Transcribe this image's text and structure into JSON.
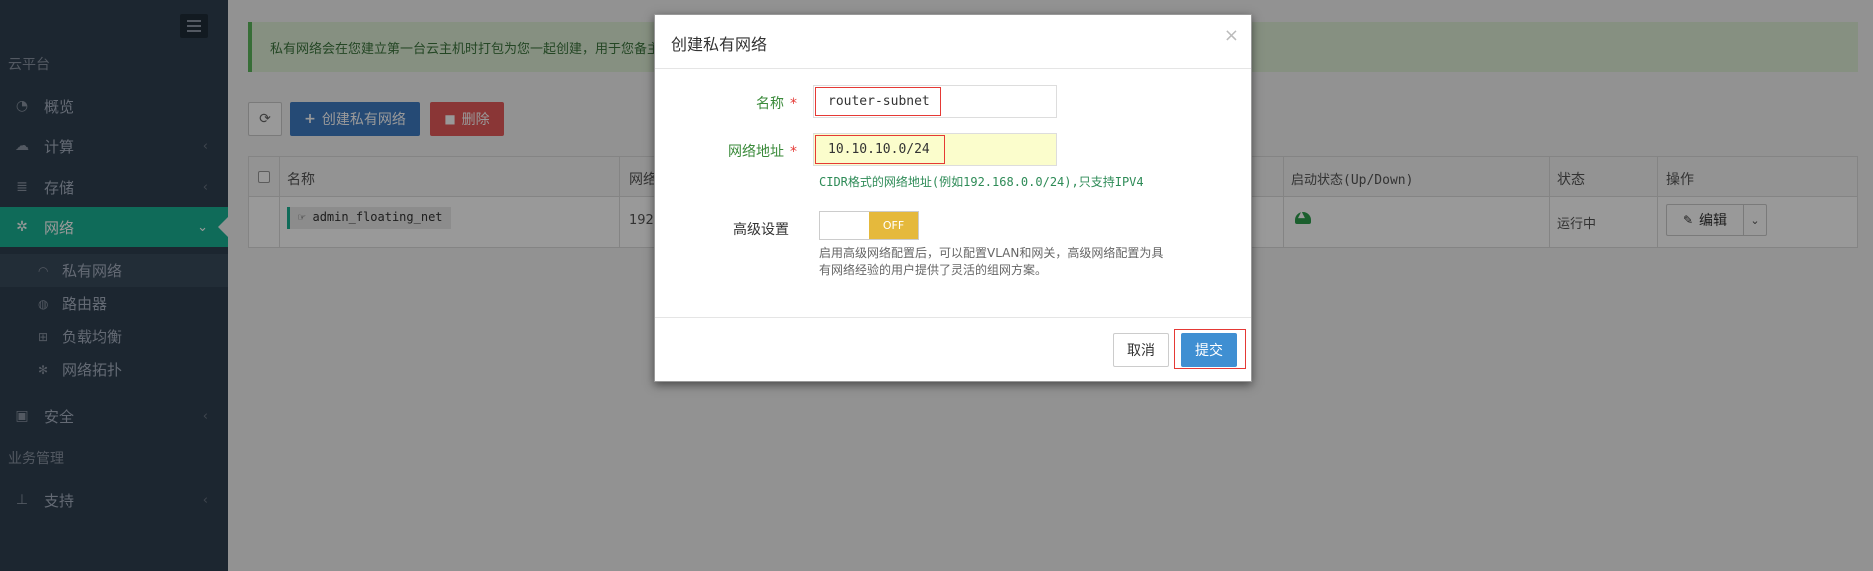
{
  "sidebar": {
    "section_cloud": "云平台",
    "items": [
      {
        "label": "概览",
        "icon": "dashboard-icon"
      },
      {
        "label": "计算",
        "icon": "cloud-icon"
      },
      {
        "label": "存储",
        "icon": "database-icon"
      },
      {
        "label": "网络",
        "icon": "network-icon"
      },
      {
        "label": "安全",
        "icon": "lock-icon"
      },
      {
        "label": "支持",
        "icon": "thumbtack-icon"
      }
    ],
    "network_sub": [
      {
        "label": "私有网络",
        "icon": "rss-icon"
      },
      {
        "label": "路由器",
        "icon": "globe-icon"
      },
      {
        "label": "负载均衡",
        "icon": "sitemap-icon"
      },
      {
        "label": "网络拓扑",
        "icon": "gear-icon"
      }
    ],
    "section_business": "业务管理"
  },
  "notice": "私有网络会在您建立第一台云主机时打包为您一起创建，用于您备主",
  "toolbar": {
    "create_label": "创建私有网络",
    "delete_label": "删除"
  },
  "table": {
    "headers": {
      "name": "名称",
      "network": "网络",
      "admin_state": "启动状态(Up/Down)",
      "status": "状态",
      "actions": "操作"
    },
    "rows": [
      {
        "name": "admin_floating_net",
        "network": "192.",
        "status": "运行中",
        "edit": "编辑"
      }
    ]
  },
  "modal": {
    "title": "创建私有网络",
    "name_label": "名称",
    "name_value": "router-subnet",
    "address_label": "网络地址",
    "address_value": "10.10.10.0/24",
    "address_hint": "CIDR格式的网络地址(例如192.168.0.0/24),只支持IPV4",
    "advanced_label": "高级设置",
    "toggle_off": "OFF",
    "advanced_hint_1": "启用高级网络配置后，可以配置VLAN和网关，高级网络配置为具",
    "advanced_hint_2": "有网络经验的用户提供了灵活的组网方案。",
    "required_mark": "*",
    "cancel_label": "取消",
    "submit_label": "提交"
  },
  "colors": {
    "sidebar_bg": "#2f4050",
    "active": "#1ab394",
    "primary": "#3f7cc4",
    "danger": "#e65b5b",
    "toggle_off": "#e5b93c"
  }
}
